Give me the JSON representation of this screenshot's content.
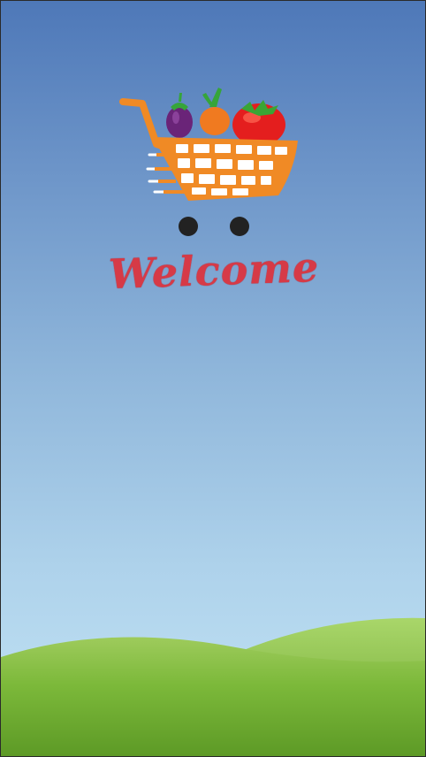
{
  "splash": {
    "welcome_text": "Welcome",
    "logo_icon": "shopping-cart-with-vegetables-icon"
  },
  "colors": {
    "sky_top": "#4e78b8",
    "sky_bottom": "#c3e4f5",
    "hill_green": "#7cb93a",
    "cart_orange": "#f08a25",
    "welcome_red": "#d63a47"
  }
}
